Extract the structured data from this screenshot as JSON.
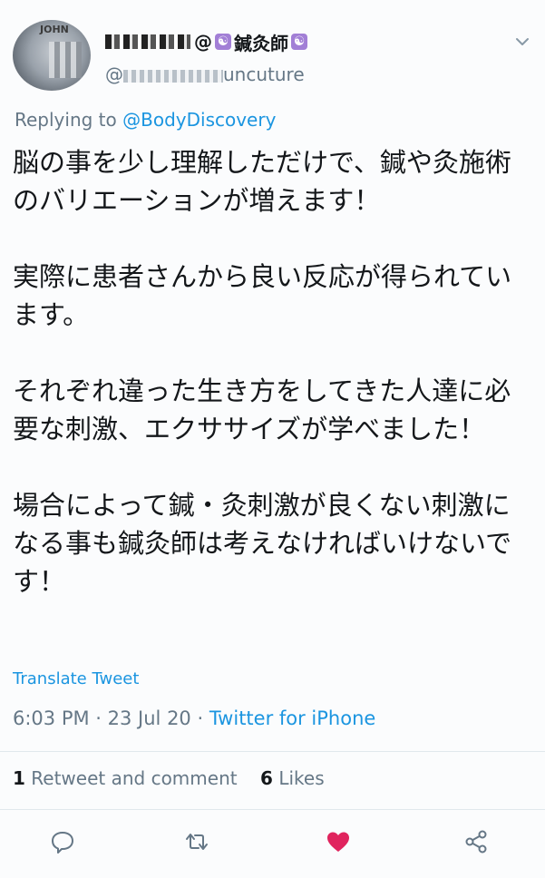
{
  "tweet": {
    "avatar_tag": "JOHN",
    "display_name_suffix": "@",
    "display_name_badge": "☯",
    "display_name_title": "鍼灸師",
    "handle_prefix": "@",
    "handle_suffix": "uncuture",
    "reply_prefix": "Replying to ",
    "reply_user": "@BodyDiscovery",
    "body": [
      "脳の事を少し理解しただけで、鍼や灸施術のバリエーションが増えます！",
      "実際に患者さんから良い反応が得られています。",
      "それぞれ違った生き方をしてきた人達に必要な刺激、エクササイズが学べました！",
      "場合によって鍼・灸刺激が良くない刺激になる事も鍼灸師は考えなければいけないです！"
    ],
    "translate_label": "Translate Tweet",
    "time": "6:03 PM",
    "date": "23 Jul 20",
    "separator": " · ",
    "source": "Twitter for iPhone",
    "retweet_count": "1",
    "retweet_label": "Retweet and comment",
    "like_count": "6",
    "like_label": "Likes"
  },
  "icons": {
    "menu": "chevron-down-icon",
    "reply": "comment-icon",
    "retweet": "retweet-icon",
    "like": "heart-icon",
    "share": "share-icon"
  },
  "colors": {
    "link": "#1b95e0",
    "secondary": "#657786",
    "like": "#e0245e",
    "badge": "#a27fd6"
  }
}
